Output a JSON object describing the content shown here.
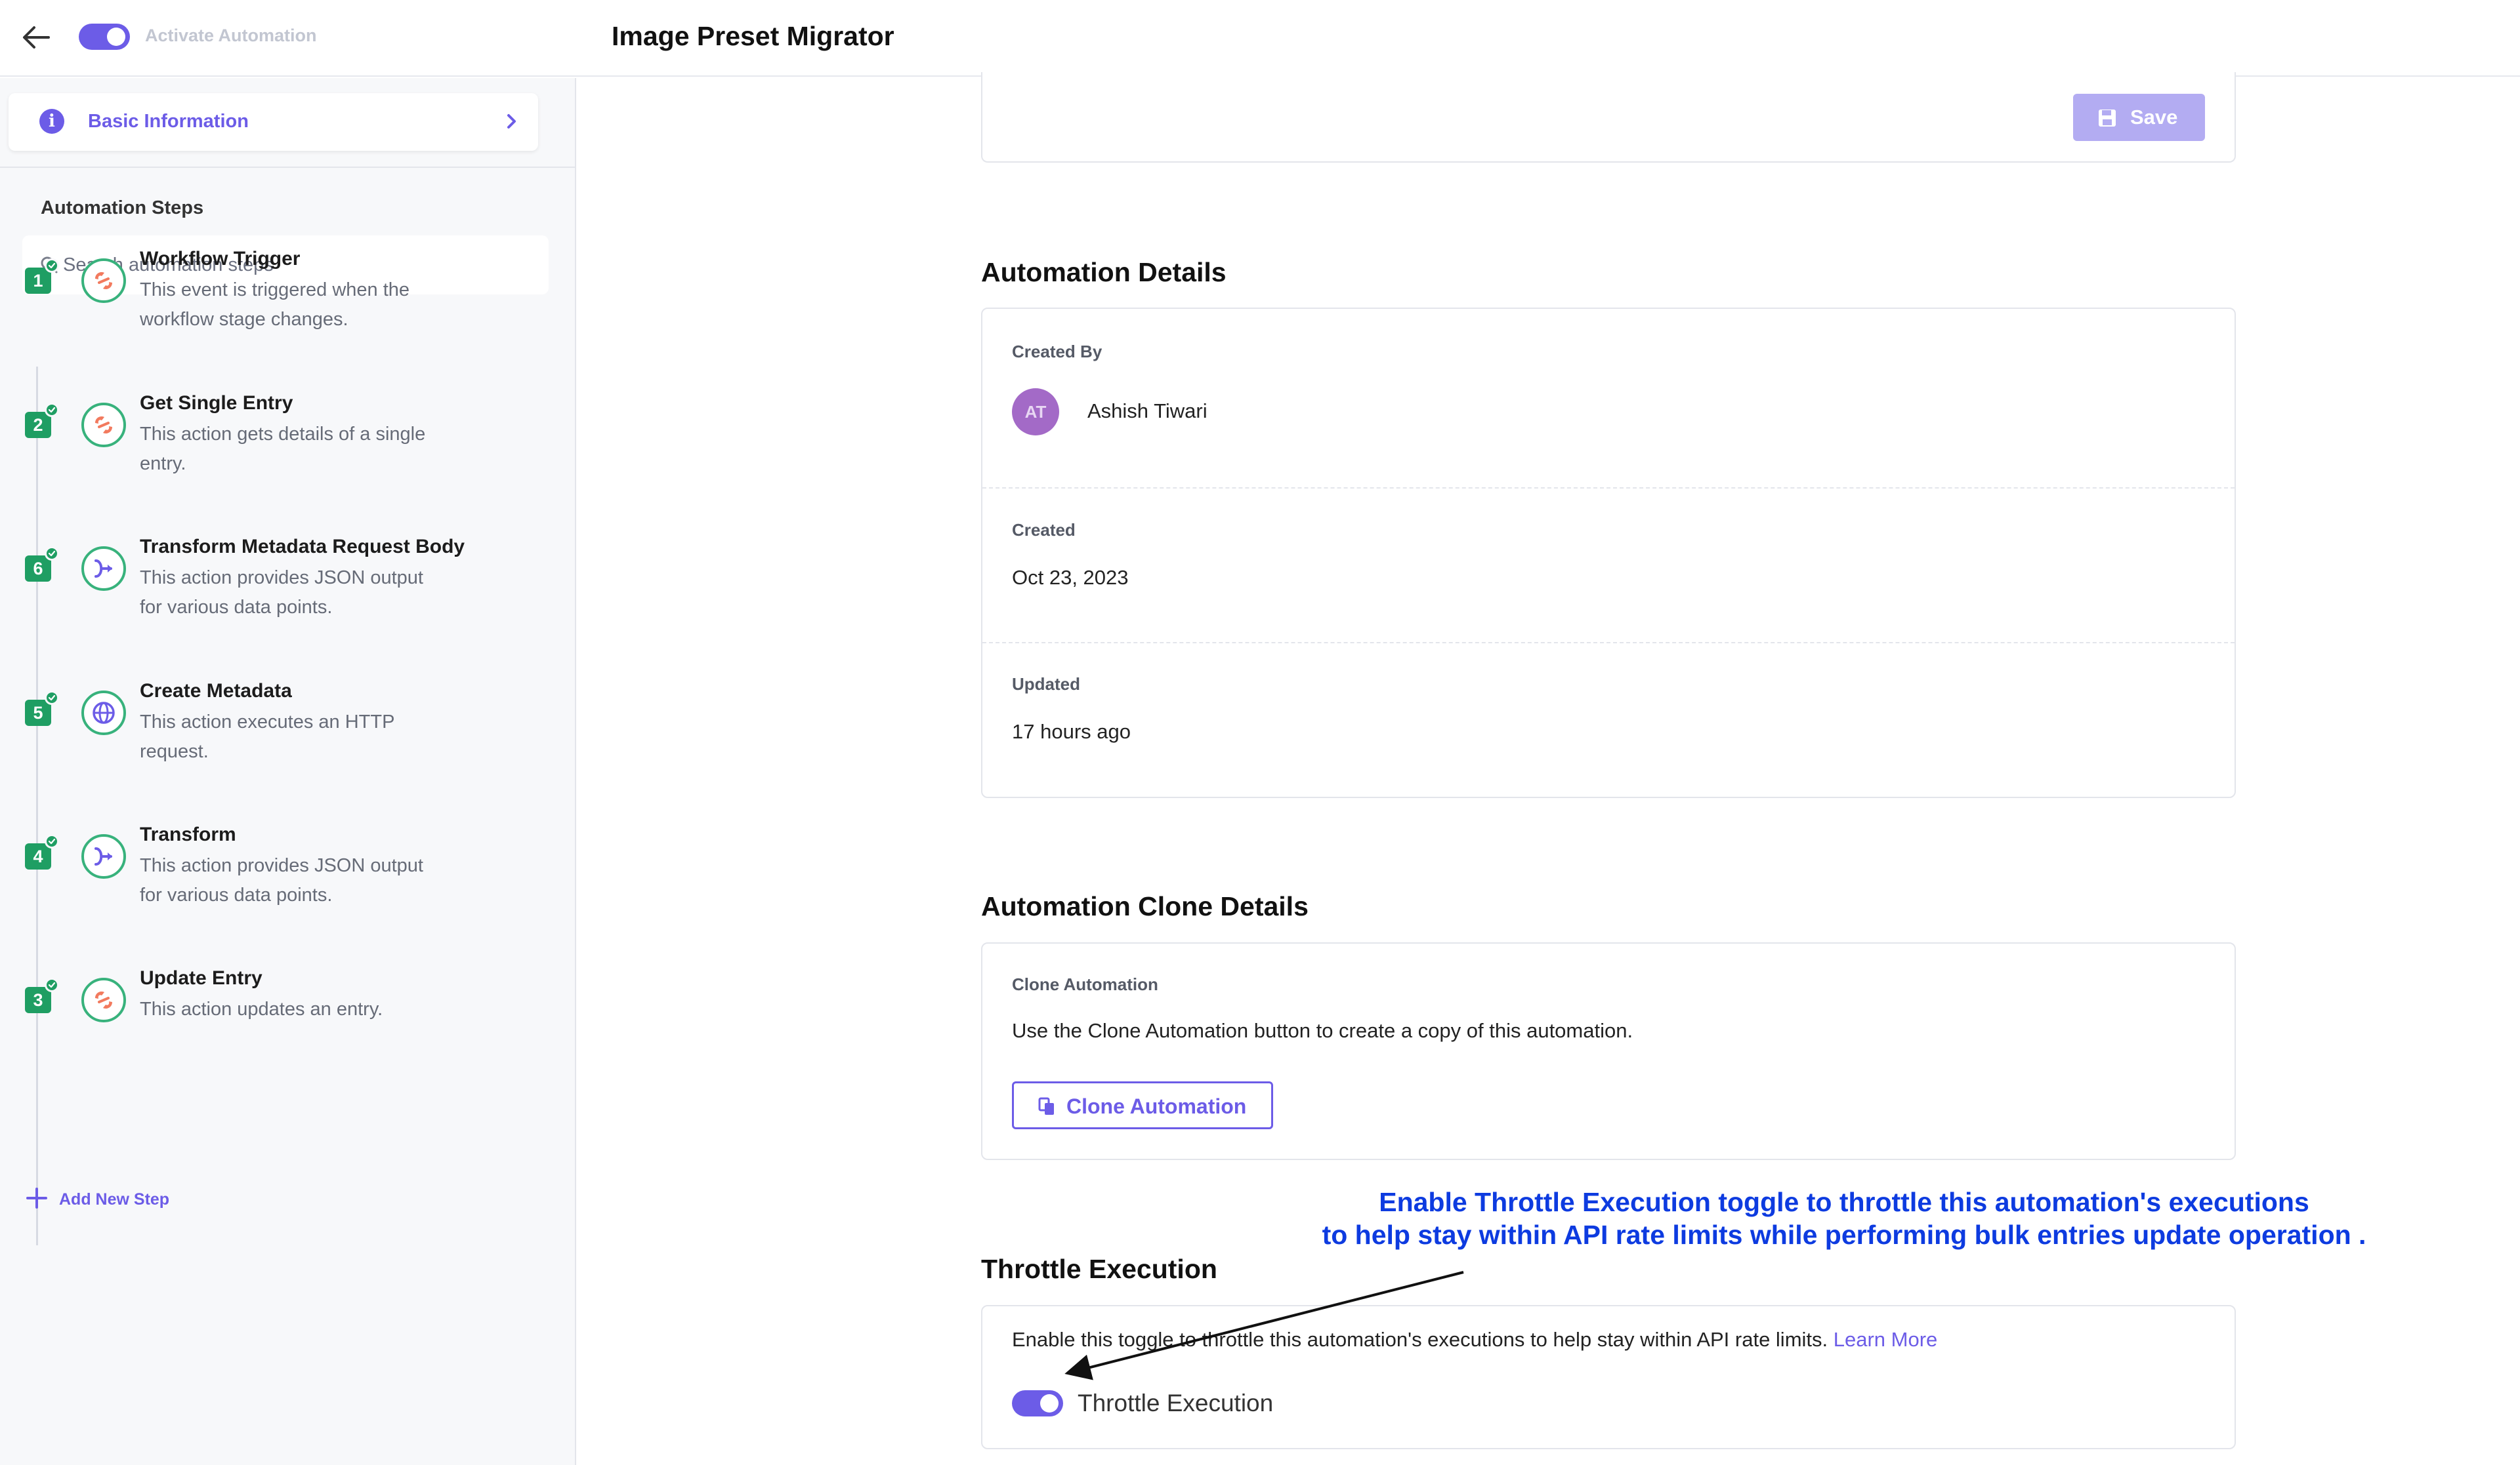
{
  "header": {
    "title": "Image Preset Migrator",
    "activate_label": "Activate Automation",
    "activate_on": true
  },
  "sidebar": {
    "basic_info_label": "Basic Information",
    "steps_title": "Automation Steps",
    "search_placeholder": "Search automation steps",
    "steps": [
      {
        "number": "1",
        "title": "Workflow Trigger",
        "description": "This event is triggered when the workflow stage changes.",
        "icon": "connector-icon"
      },
      {
        "number": "2",
        "title": "Get Single Entry",
        "description": "This action gets details of a single entry.",
        "icon": "connector-icon"
      },
      {
        "number": "6",
        "title": "Transform Metadata Request Body",
        "description": "This action provides JSON output for various data points.",
        "icon": "transform-icon"
      },
      {
        "number": "5",
        "title": "Create Metadata",
        "description": "This action executes an HTTP request.",
        "icon": "globe-icon"
      },
      {
        "number": "4",
        "title": "Transform",
        "description": "This action provides JSON output for various data points.",
        "icon": "transform-icon"
      },
      {
        "number": "3",
        "title": "Update Entry",
        "description": "This action updates an entry.",
        "icon": "connector-icon"
      }
    ],
    "add_step_label": "Add New Step"
  },
  "main": {
    "save_label": "Save",
    "details": {
      "heading": "Automation Details",
      "created_by_label": "Created By",
      "created_by_initials": "AT",
      "created_by_name": "Ashish Tiwari",
      "created_label": "Created",
      "created_value": "Oct 23, 2023",
      "updated_label": "Updated",
      "updated_value": "17 hours ago"
    },
    "clone": {
      "heading": "Automation Clone Details",
      "label": "Clone Automation",
      "description": "Use the Clone Automation button to create a copy of this automation.",
      "button_label": "Clone Automation"
    },
    "throttle": {
      "heading": "Throttle Execution",
      "description": "Enable this toggle to throttle this automation's executions to help stay within API rate limits.",
      "learn_more": "Learn More",
      "toggle_label": "Throttle Execution",
      "toggle_on": true
    }
  },
  "annotation": {
    "line1": "Enable Throttle Execution toggle to throttle this automation's executions",
    "line2": "to help stay within API rate limits while performing bulk entries update operation ."
  },
  "colors": {
    "accent": "#6c5ce7",
    "step_green": "#1f9e63",
    "annotation_blue": "#0d3be0"
  }
}
